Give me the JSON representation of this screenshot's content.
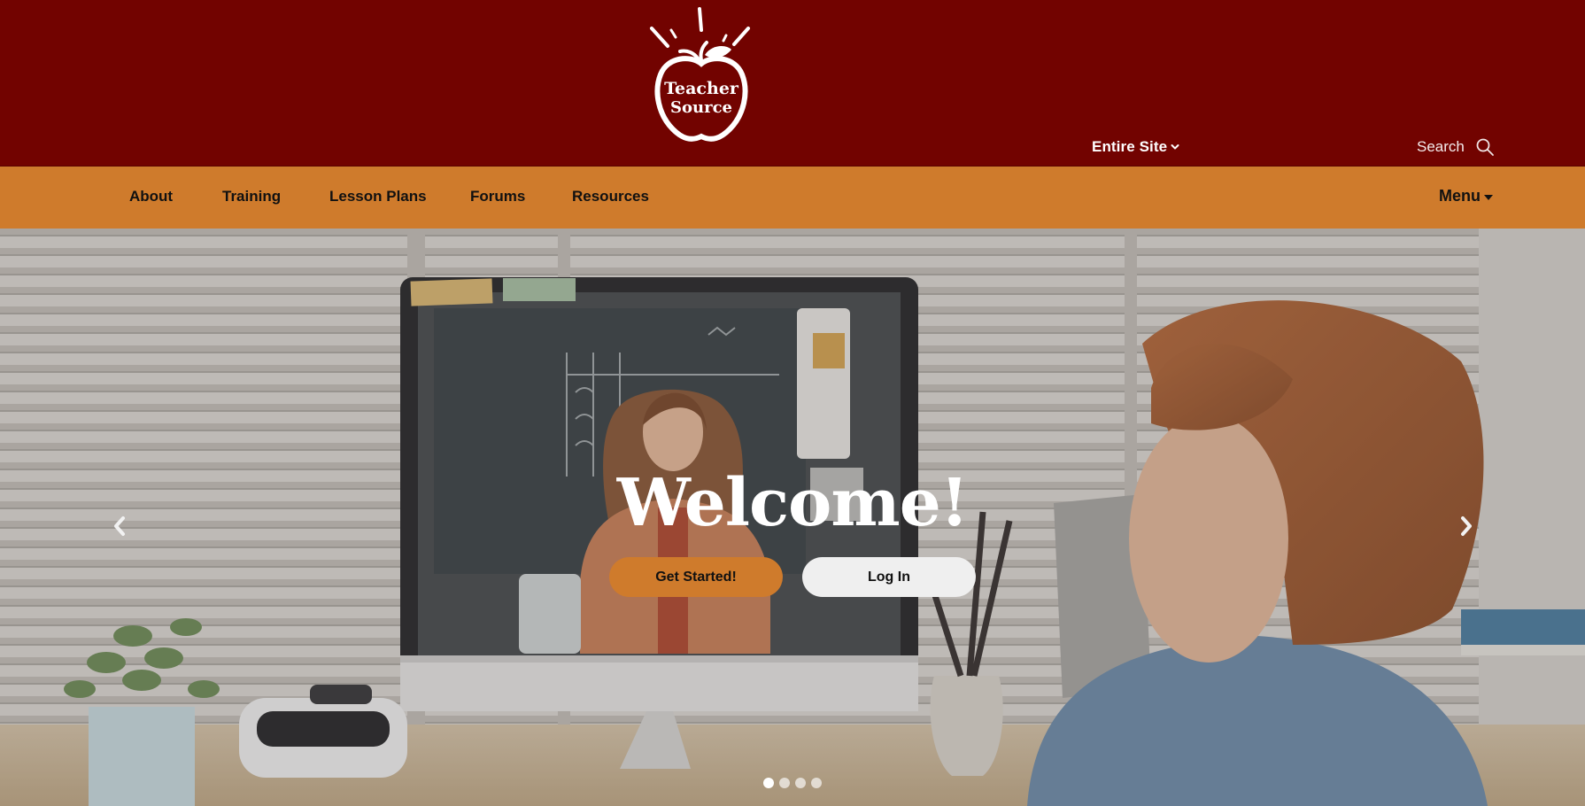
{
  "site": {
    "logo_line1": "Teacher",
    "logo_line2": "Source",
    "logo_icon": "apple-icon"
  },
  "header": {
    "scope_label": "Entire Site",
    "scope_icon": "chevron-down-icon",
    "search_placeholder": "Search",
    "search_icon": "magnifier-icon"
  },
  "nav": {
    "items": [
      {
        "label": "About"
      },
      {
        "label": "Training"
      },
      {
        "label": "Lesson Plans"
      },
      {
        "label": "Forums"
      },
      {
        "label": "Resources"
      }
    ],
    "menu_label": "Menu"
  },
  "hero": {
    "heading": "Welcome!",
    "primary_button": "Get Started!",
    "secondary_button": "Log In",
    "prev_icon": "chevron-left-icon",
    "next_icon": "chevron-right-icon",
    "slide_count": 4,
    "active_slide": 1
  },
  "colors": {
    "header_bg": "#720300",
    "nav_bg": "#cf7b2c",
    "primary_button": "#cf7b2c",
    "secondary_button": "#efefef",
    "text_light": "#ffffff",
    "text_dark": "#111111"
  }
}
